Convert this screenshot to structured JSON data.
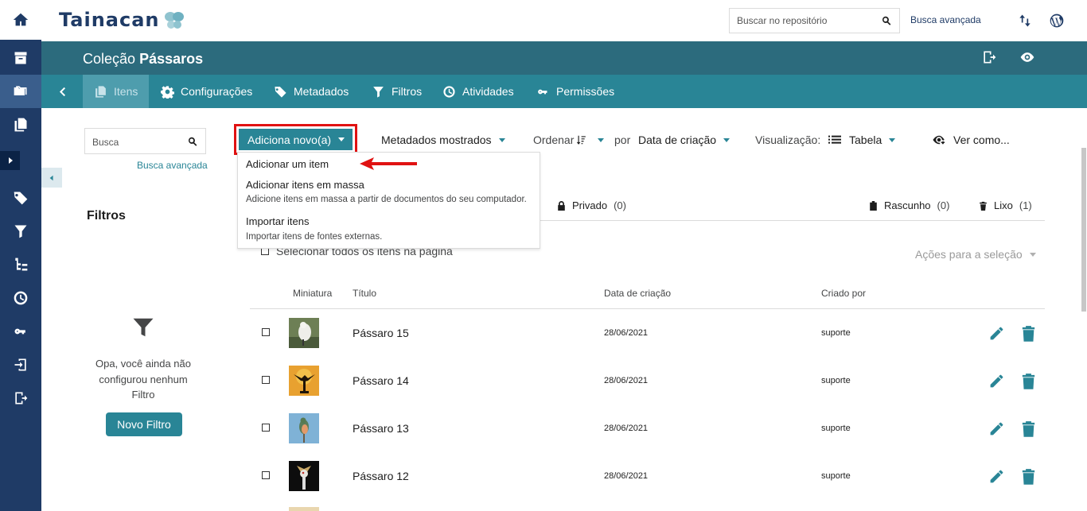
{
  "topbar": {
    "logo": "Tainacan",
    "search_placeholder": "Buscar no repositório",
    "advanced_search": "Busca avançada"
  },
  "collection": {
    "prefix": "Coleção",
    "name": "Pássaros"
  },
  "tabs": [
    {
      "label": "Itens",
      "active": true
    },
    {
      "label": "Configurações"
    },
    {
      "label": "Metadados"
    },
    {
      "label": "Filtros"
    },
    {
      "label": "Atividades"
    },
    {
      "label": "Permissões"
    }
  ],
  "sidebar": {
    "search_placeholder": "Busca",
    "advanced_search": "Busca avançada",
    "filters_title": "Filtros",
    "empty_message": "Opa, você ainda não configurou nenhum Filtro",
    "new_filter_button": "Novo Filtro"
  },
  "toolbar": {
    "add_new": "Adiciona novo(a)",
    "shown_metadata": "Metadados mostrados",
    "sort_label": "Ordenar",
    "by_label": "por",
    "sort_field": "Data de criação",
    "view_label": "Visualização:",
    "view_mode": "Tabela",
    "see_as": "Ver como..."
  },
  "dropdown": {
    "add_one": "Adicionar um item",
    "bulk_add": "Adicionar itens em massa",
    "bulk_add_desc": "Adicione itens em massa a partir de documentos do seu computador.",
    "import": "Importar itens",
    "import_desc": "Importar itens de fontes externas."
  },
  "status": {
    "private": "Privado",
    "private_count": "(0)",
    "draft": "Rascunho",
    "draft_count": "(0)",
    "trash": "Lixo",
    "trash_count": "(1)"
  },
  "list": {
    "select_all": "Selecionar todos os itens na página",
    "bulk_actions": "Ações para a seleção",
    "columns": {
      "thumbnail": "Miniatura",
      "title": "Título",
      "created": "Data de criação",
      "author": "Criado por"
    },
    "rows": [
      {
        "title": "Pássaro 15",
        "date": "28/06/2021",
        "author": "suporte"
      },
      {
        "title": "Pássaro 14",
        "date": "28/06/2021",
        "author": "suporte"
      },
      {
        "title": "Pássaro 13",
        "date": "28/06/2021",
        "author": "suporte"
      },
      {
        "title": "Pássaro 12",
        "date": "28/06/2021",
        "author": "suporte"
      }
    ]
  },
  "colors": {
    "rail": "#1f3b66",
    "collection_bar": "#2c6b7d",
    "tab_bar": "#298596",
    "accent": "#298596",
    "highlight": "#e01212"
  }
}
